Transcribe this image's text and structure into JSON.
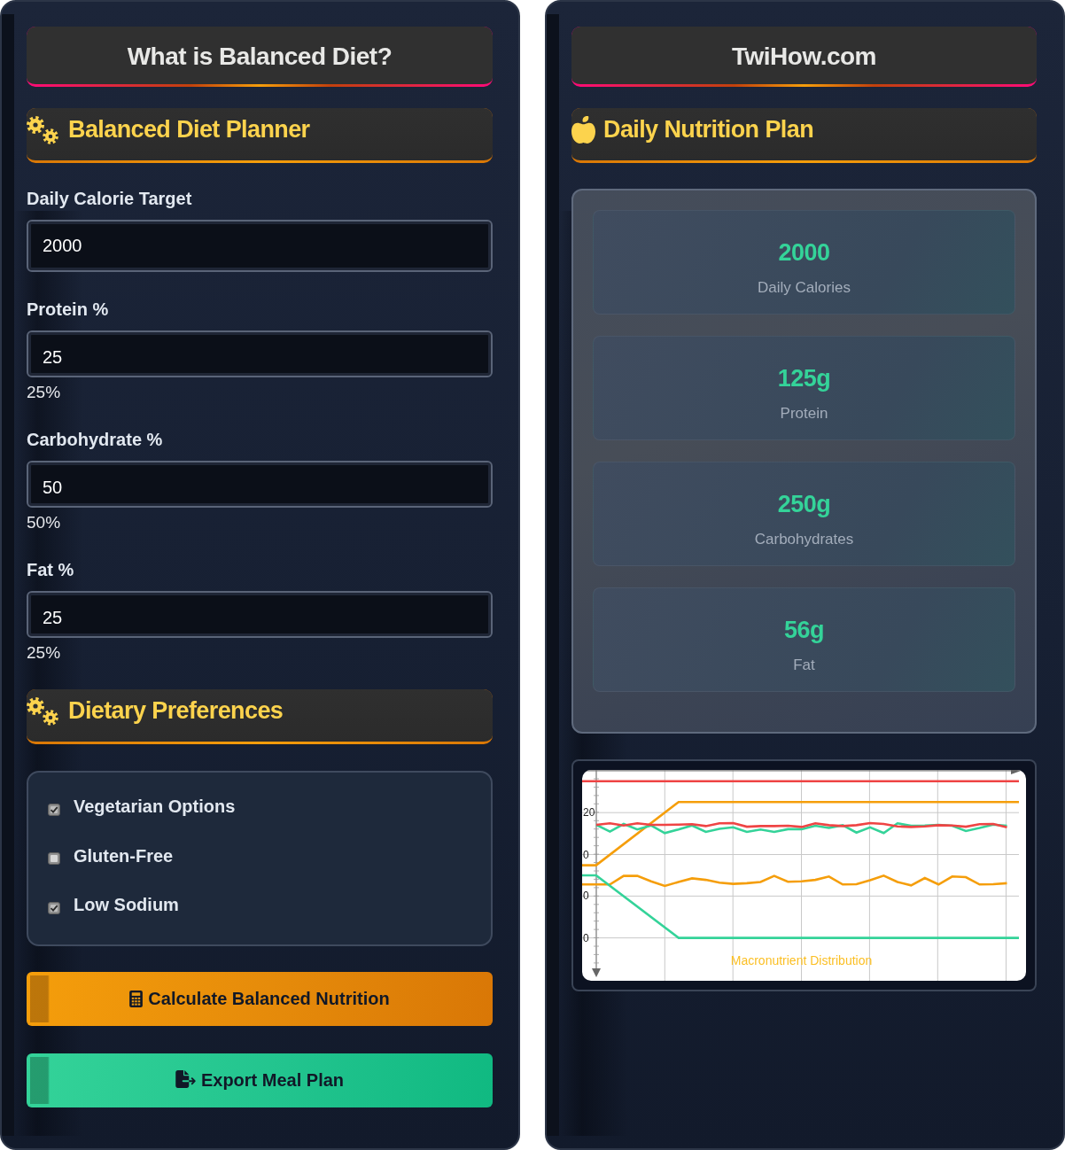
{
  "left_panel": {
    "banner": {
      "title": "What is Balanced Diet?"
    },
    "planner_header": {
      "title": "Balanced Diet Planner"
    },
    "fields": [
      {
        "kind": "number",
        "label": "Daily Calorie Target",
        "value": "2000"
      },
      {
        "kind": "percent",
        "label": "Protein %",
        "value": "25",
        "reading": "25%"
      },
      {
        "kind": "percent",
        "label": "Carbohydrate %",
        "value": "50",
        "reading": "50%"
      },
      {
        "kind": "percent",
        "label": "Fat %",
        "value": "25",
        "reading": "25%"
      }
    ],
    "preferences_header": {
      "title": "Dietary Preferences"
    },
    "preferences": [
      {
        "label": "Vegetarian Options",
        "checked": true
      },
      {
        "label": "Gluten-Free",
        "checked": false
      },
      {
        "label": "Low Sodium",
        "checked": true
      }
    ],
    "buttons": [
      {
        "kind": "calculate",
        "label": "Calculate Balanced Nutrition"
      },
      {
        "kind": "export",
        "label": "Export Meal Plan"
      }
    ]
  },
  "right_panel": {
    "banner": {
      "title": "TwiHow.com"
    },
    "plan_header": {
      "title": "Daily Nutrition Plan"
    },
    "stats": [
      {
        "value": "2000",
        "label": "Daily Calories"
      },
      {
        "value": "125g",
        "label": "Protein"
      },
      {
        "value": "250g",
        "label": "Carbohydrates"
      },
      {
        "value": "56g",
        "label": "Fat"
      }
    ],
    "chart": {
      "title": "Macronutrient Distribution",
      "y_tick_labels": [
        "20",
        "0",
        "0",
        "0"
      ]
    }
  }
}
